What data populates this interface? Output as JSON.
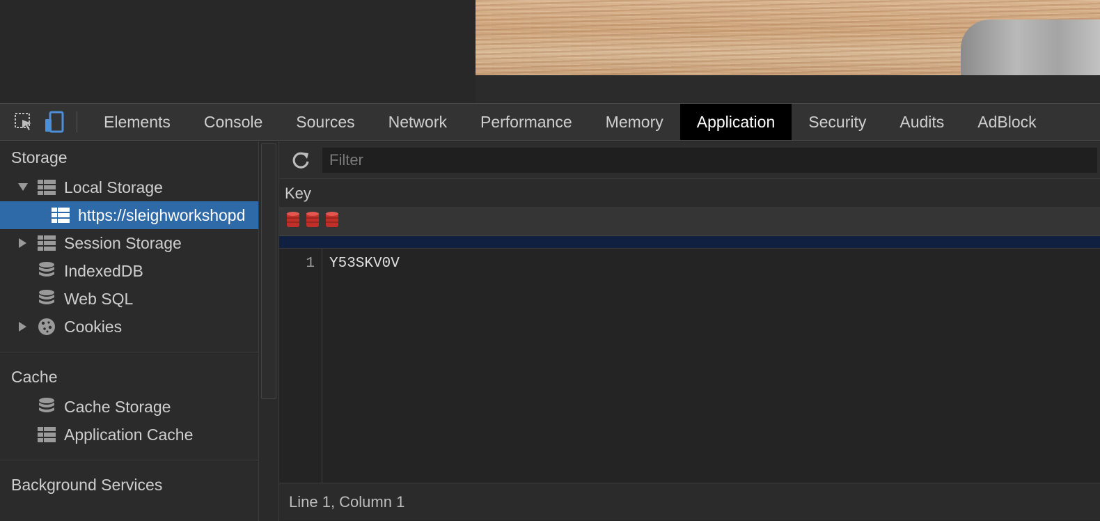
{
  "toolbar": {
    "tabs": [
      {
        "label": "Elements"
      },
      {
        "label": "Console"
      },
      {
        "label": "Sources"
      },
      {
        "label": "Network"
      },
      {
        "label": "Performance"
      },
      {
        "label": "Memory"
      },
      {
        "label": "Application",
        "active": true
      },
      {
        "label": "Security"
      },
      {
        "label": "Audits"
      },
      {
        "label": "AdBlock"
      }
    ]
  },
  "sidebar": {
    "storage_title": "Storage",
    "storage_items": [
      {
        "label": "Local Storage",
        "icon": "grid-icon",
        "expanded": true
      },
      {
        "label": "https://sleighworkshopd",
        "icon": "grid-icon",
        "selected": true
      },
      {
        "label": "Session Storage",
        "icon": "grid-icon",
        "expanded": false
      },
      {
        "label": "IndexedDB",
        "icon": "database-icon"
      },
      {
        "label": "Web SQL",
        "icon": "database-icon"
      },
      {
        "label": "Cookies",
        "icon": "cookie-icon",
        "expanded": false
      }
    ],
    "cache_title": "Cache",
    "cache_items": [
      {
        "label": "Cache Storage",
        "icon": "database-icon"
      },
      {
        "label": "Application Cache",
        "icon": "grid-icon"
      }
    ],
    "background_title": "Background Services"
  },
  "main": {
    "filter_placeholder": "Filter",
    "column_key": "Key",
    "editor": {
      "line_number": "1",
      "line_text": "Y53SKV0V"
    },
    "status": "Line 1, Column 1"
  },
  "colors": {
    "active_tab_bg": "#000000",
    "selected_item_bg": "#2e6aa8",
    "icon_accent": "#4c8fd6",
    "db_red": "#c0302a"
  }
}
